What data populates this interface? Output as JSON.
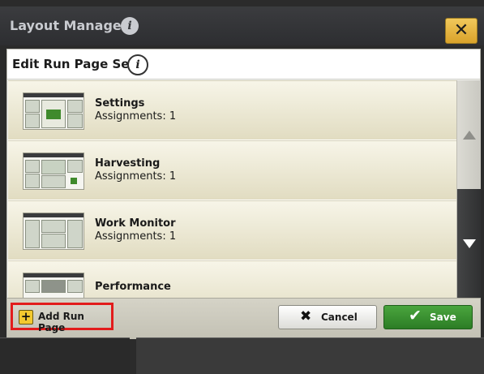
{
  "topbar": {
    "title": "Layout Manager",
    "close_symbol": "✕"
  },
  "dialog": {
    "title": "Edit Run Page Set",
    "info_symbol": "i",
    "items": [
      {
        "name": "Settings",
        "assignments": "Assignments: 1"
      },
      {
        "name": "Harvesting",
        "assignments": "Assignments: 1"
      },
      {
        "name": "Work Monitor",
        "assignments": "Assignments: 1"
      },
      {
        "name": "Performance",
        "assignments": ""
      }
    ]
  },
  "footer": {
    "add_label": "Add Run Page",
    "add_symbol": "+",
    "cancel_label": "Cancel",
    "cancel_symbol": "✖",
    "save_label": "Save",
    "save_symbol": "✔"
  },
  "colors": {
    "highlight": "#e21c1c",
    "save_green": "#2c7d25",
    "close_yellow": "#e8b640"
  },
  "icons": [
    "info-icon",
    "close-icon",
    "scroll-up-icon",
    "scroll-down-icon",
    "plus-icon",
    "cancel-x-icon",
    "check-icon",
    "run-page-thumbnail"
  ]
}
